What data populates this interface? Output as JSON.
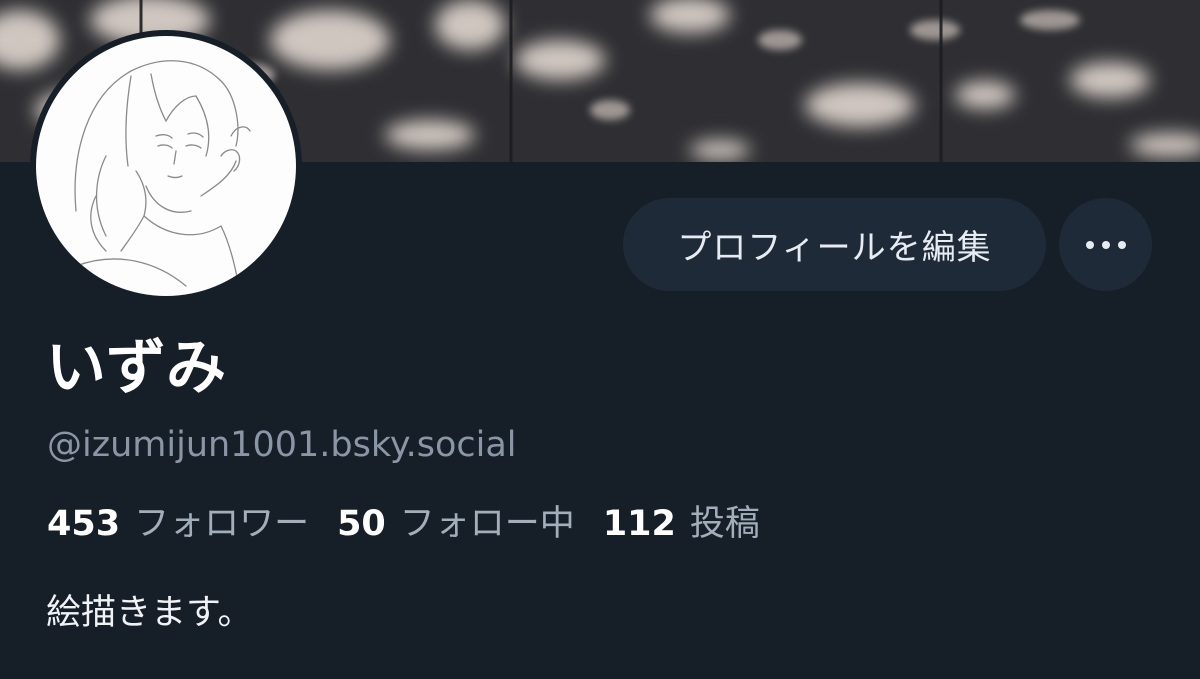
{
  "profile": {
    "display_name": "いずみ",
    "handle": "@izumijun1001.bsky.social",
    "bio": "絵描きます。"
  },
  "actions": {
    "edit_profile_label": "プロフィールを編集",
    "more_icon": "ellipsis-icon"
  },
  "stats": [
    {
      "value": "453",
      "label": "フォロワー"
    },
    {
      "value": "50",
      "label": "フォロー中"
    },
    {
      "value": "112",
      "label": "投稿"
    }
  ],
  "colors": {
    "background": "#161e27",
    "button_bg": "#1f2a38",
    "secondary_text": "#8a96a6"
  }
}
